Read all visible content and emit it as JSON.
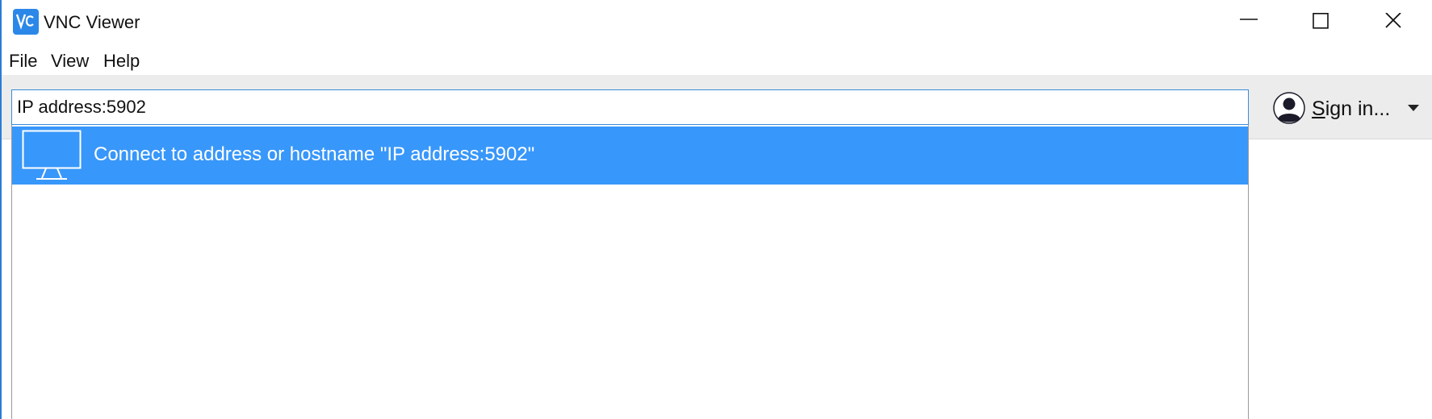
{
  "window": {
    "title": "VNC Viewer",
    "app_icon": "vnc-viewer-logo",
    "controls": [
      "minimize-icon",
      "maximize-icon",
      "close-icon"
    ]
  },
  "menu": {
    "file": "File",
    "view": "View",
    "help": "Help"
  },
  "toolbar": {
    "address_value": "IP address:5902",
    "sign_in_prefix": "S",
    "sign_in_rest": "ign in...",
    "sign_in_icon": "user-avatar-icon",
    "dropdown_icon": "caret-down-icon"
  },
  "suggestions": [
    {
      "icon": "monitor-icon",
      "label": "Connect to address or hostname \"IP address:5902\"",
      "selected": true
    }
  ],
  "colors": {
    "accent": "#3897fa",
    "logo": "#2b88e8",
    "window_border": "#2b7bd6"
  }
}
